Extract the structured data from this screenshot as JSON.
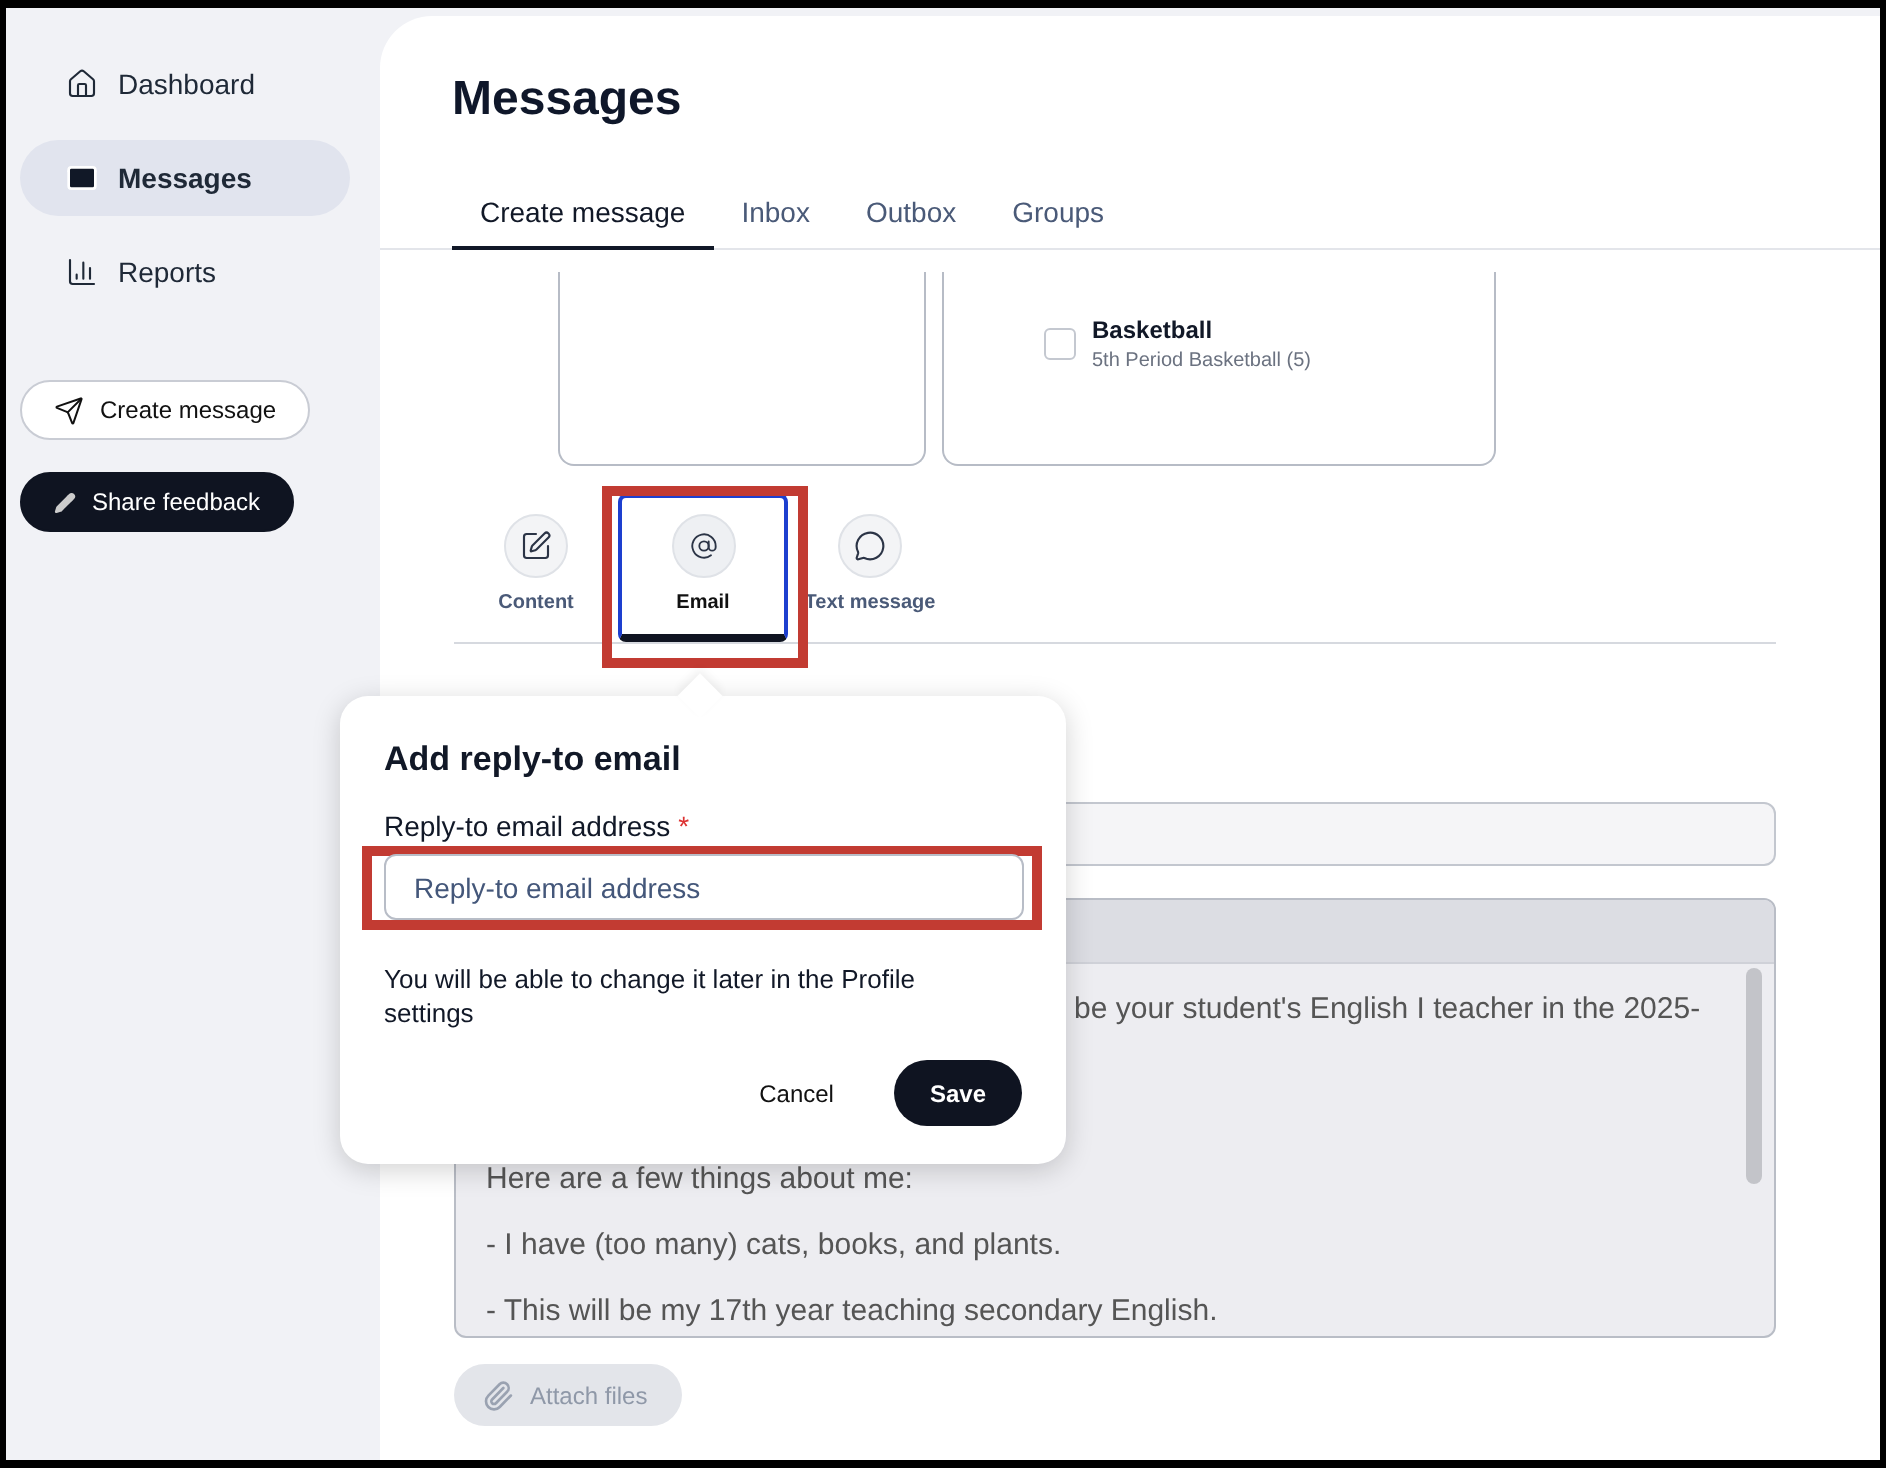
{
  "sidebar": {
    "nav": [
      {
        "label": "Dashboard",
        "selected": false
      },
      {
        "label": "Messages",
        "selected": true
      },
      {
        "label": "Reports",
        "selected": false
      }
    ],
    "actions": [
      {
        "label": "Create message",
        "kind": "outline"
      },
      {
        "label": "Share feedback",
        "kind": "dark"
      }
    ]
  },
  "page": {
    "title": "Messages"
  },
  "tabs": [
    {
      "label": "Create message",
      "selected": true
    },
    {
      "label": "Inbox",
      "selected": false
    },
    {
      "label": "Outbox",
      "selected": false
    },
    {
      "label": "Groups",
      "selected": false
    }
  ],
  "recipient_card": {
    "title": "Basketball",
    "subtitle": "5th Period Basketball (5)",
    "checked": false
  },
  "channels": [
    {
      "label": "Content",
      "selected": false
    },
    {
      "label": "Email",
      "selected": true
    },
    {
      "label": "Text message",
      "selected": false
    }
  ],
  "editor": {
    "lines": [
      "be your student's English I teacher in the 2025-",
      "Here are a few things about me:",
      "- I have (too many) cats, books, and plants.",
      "- This will be my 17th year teaching secondary English."
    ]
  },
  "attach": {
    "label": "Attach files",
    "disabled": true
  },
  "popover": {
    "title": "Add reply-to email",
    "field_label": "Reply-to email address",
    "required_mark": "*",
    "placeholder": "Reply-to email address",
    "help": "You will be able to change it later in the Profile settings",
    "buttons": [
      {
        "label": "Cancel",
        "kind": "plain"
      },
      {
        "label": "Save",
        "kind": "primary"
      }
    ]
  }
}
